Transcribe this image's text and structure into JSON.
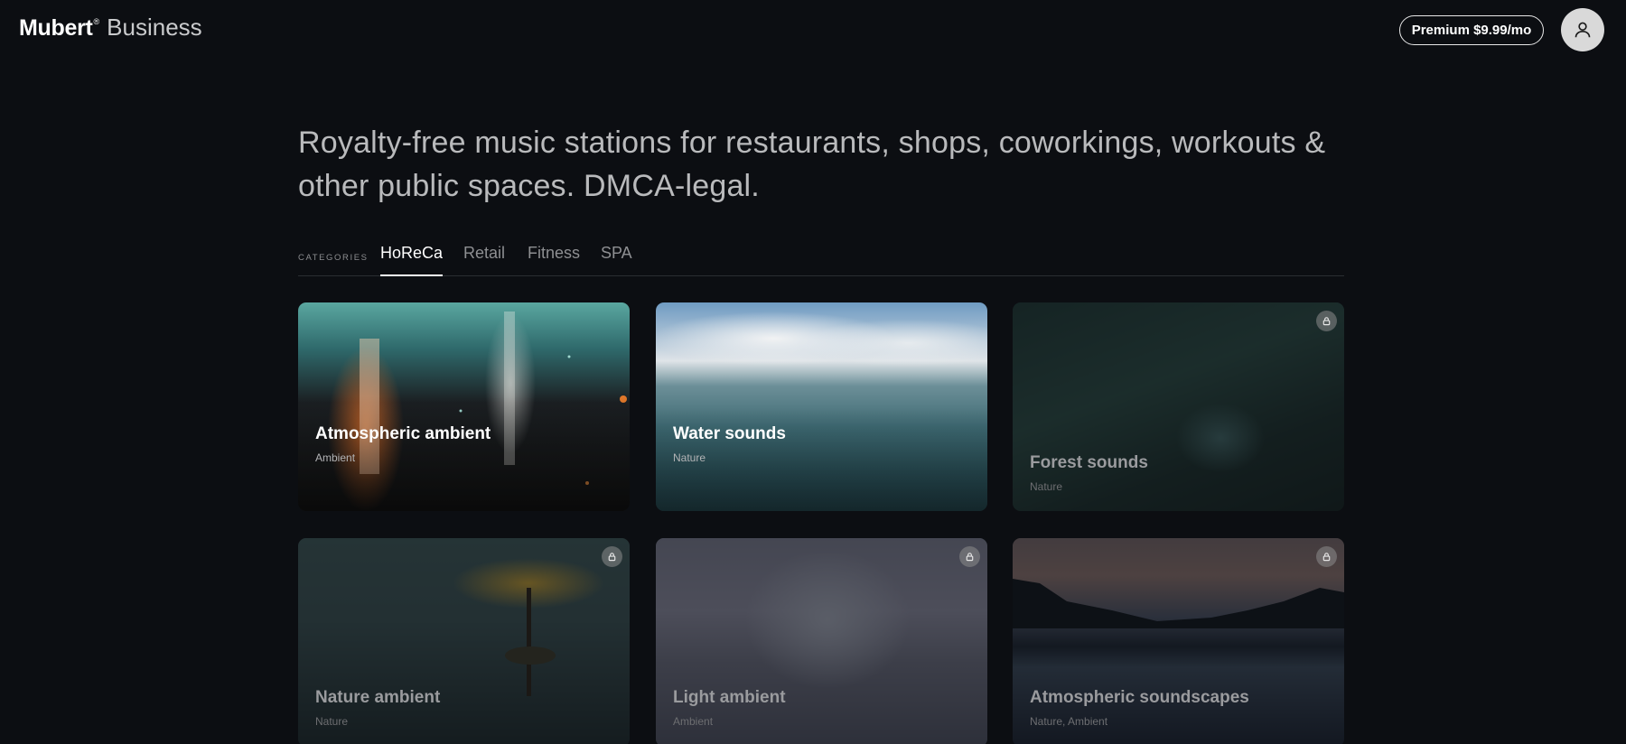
{
  "header": {
    "brand": "Mubert",
    "brand_mark": "®",
    "product": "Business",
    "premium_label": "Premium $9.99/mo",
    "avatar_icon": "user-icon"
  },
  "hero": {
    "text": "Royalty-free music stations for restaurants, shops, coworkings, workouts & other public spaces. DMCA-legal."
  },
  "categories": {
    "label": "CATEGORIES",
    "tabs": [
      {
        "label": "HoReCa",
        "active": true
      },
      {
        "label": "Retail",
        "active": false
      },
      {
        "label": "Fitness",
        "active": false
      },
      {
        "label": "SPA",
        "active": false
      }
    ]
  },
  "stations": [
    {
      "title": "Atmospheric ambient",
      "tags": "Ambient",
      "locked": false
    },
    {
      "title": "Water sounds",
      "tags": "Nature",
      "locked": false
    },
    {
      "title": "Forest sounds",
      "tags": "Nature",
      "locked": true
    },
    {
      "title": "Nature ambient",
      "tags": "Nature",
      "locked": true
    },
    {
      "title": "Light ambient",
      "tags": "Ambient",
      "locked": true
    },
    {
      "title": "Atmospheric soundscapes",
      "tags": "Nature, Ambient",
      "locked": true
    }
  ]
}
